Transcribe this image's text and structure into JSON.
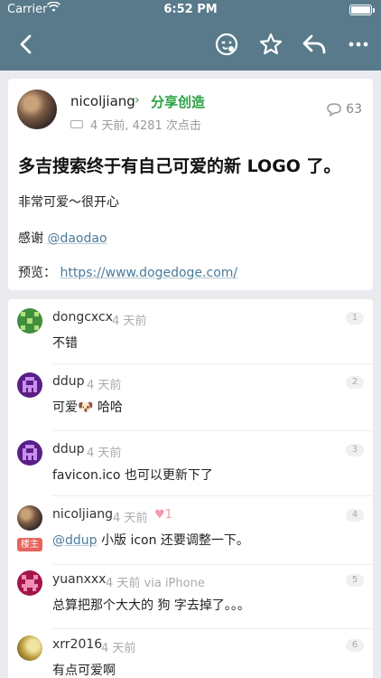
{
  "status": {
    "carrier": "Carrier",
    "time": "6:52 PM"
  },
  "nav": {
    "back_icon": "chevron-left-icon",
    "actions": [
      "emoji-icon",
      "star-icon",
      "reply-icon",
      "more-icon"
    ]
  },
  "topic": {
    "author": "nicoljiang",
    "node_arrow": "›",
    "node": "分享创造",
    "meta": "4 天前, 4281 次点击",
    "reply_count": "63",
    "title": "多吉搜索终于有自己可爱的新 LOGO 了。",
    "para1": "非常可爱～很开心",
    "thanks_prefix": "感谢 ",
    "thanks_mention": "@daodao",
    "preview_prefix": "预览：",
    "preview_link": "https://www.dogedoge.com/"
  },
  "replies": [
    {
      "user": "dongcxcx",
      "time": "4 天前",
      "num": "1",
      "content": "不错"
    },
    {
      "user": "ddup",
      "time": "4 天前",
      "num": "2",
      "content": "可爱🐶 哈哈"
    },
    {
      "user": "ddup",
      "time": "4 天前",
      "num": "3",
      "content": "favicon.ico 也可以更新下了"
    },
    {
      "user": "nicoljiang",
      "time": "4 天前",
      "num": "4",
      "likes": "1",
      "badge": "楼主",
      "mention": "@ddup",
      "content": " 小版 icon 还要调整一下。"
    },
    {
      "user": "yuanxxx",
      "time": "4 天前 via iPhone",
      "num": "5",
      "content": "总算把那个大大的 狗 字去掉了。。。"
    },
    {
      "user": "xrr2016",
      "time": "4 天前",
      "num": "6",
      "content": "有点可爱啊"
    }
  ],
  "colors": {
    "nav": "#587a8a",
    "node": "#2ba245",
    "link": "#4a7a9b",
    "badge": "#e8635b"
  }
}
